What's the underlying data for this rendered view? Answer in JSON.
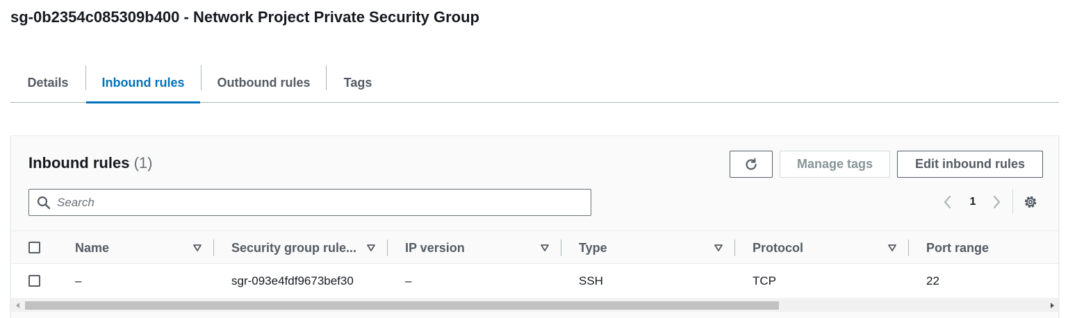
{
  "page": {
    "title": "sg-0b2354c085309b400 - Network Project Private Security Group"
  },
  "tabs": [
    {
      "label": "Details",
      "active": false
    },
    {
      "label": "Inbound rules",
      "active": true
    },
    {
      "label": "Outbound rules",
      "active": false
    },
    {
      "label": "Tags",
      "active": false
    }
  ],
  "panel": {
    "title": "Inbound rules",
    "count": "(1)",
    "buttons": {
      "refresh_icon": "refresh-icon",
      "manage_tags": "Manage tags",
      "edit_inbound_rules": "Edit inbound rules"
    },
    "search": {
      "placeholder": "Search",
      "value": ""
    },
    "pagination": {
      "current_page": "1"
    }
  },
  "table": {
    "columns": [
      "Name",
      "Security group rule...",
      "IP version",
      "Type",
      "Protocol",
      "Port range"
    ],
    "rows": [
      {
        "name": "–",
        "security_group_rule": "sgr-093e4fdf9673bef30",
        "ip_version": "–",
        "type": "SSH",
        "protocol": "TCP",
        "port_range": "22"
      }
    ]
  },
  "colors": {
    "accent": "#0073bb",
    "text": "#16191f",
    "muted": "#545b64",
    "disabled": "#879596"
  }
}
